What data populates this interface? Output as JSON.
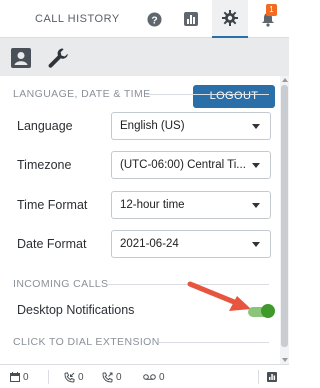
{
  "header": {
    "title": "CALL HISTORY",
    "notification_count": "1",
    "icons": [
      "help-icon",
      "stats-icon",
      "settings-icon",
      "bell-icon"
    ]
  },
  "subheader": {
    "icons": [
      "contact-card-icon",
      "wrench-icon"
    ],
    "logout_label": "LOGOUT"
  },
  "sections": {
    "lang": {
      "title": "LANGUAGE, DATE & TIME",
      "rows": [
        {
          "label": "Language",
          "value": "English (US)"
        },
        {
          "label": "Timezone",
          "value": "(UTC-06:00) Central Ti..."
        },
        {
          "label": "Time Format",
          "value": "12-hour time"
        },
        {
          "label": "Date Format",
          "value": "2021-06-24"
        }
      ]
    },
    "incoming": {
      "title": "INCOMING CALLS",
      "desktop_notifications_label": "Desktop Notifications",
      "desktop_notifications_on": true
    },
    "click_to_dial": {
      "title": "CLICK TO DIAL EXTENSION"
    }
  },
  "statusbar": {
    "items": [
      {
        "icon": "calendar-icon",
        "value": "0"
      },
      {
        "icon": "incoming-call-icon",
        "value": "0"
      },
      {
        "icon": "outgoing-call-icon",
        "value": "0"
      },
      {
        "icon": "voicemail-icon",
        "value": "0"
      }
    ]
  },
  "colors": {
    "accent": "#2b6fa8",
    "toggle_on": "#3f9a2b",
    "badge": "#f26b21",
    "arrow": "#e8553f"
  }
}
